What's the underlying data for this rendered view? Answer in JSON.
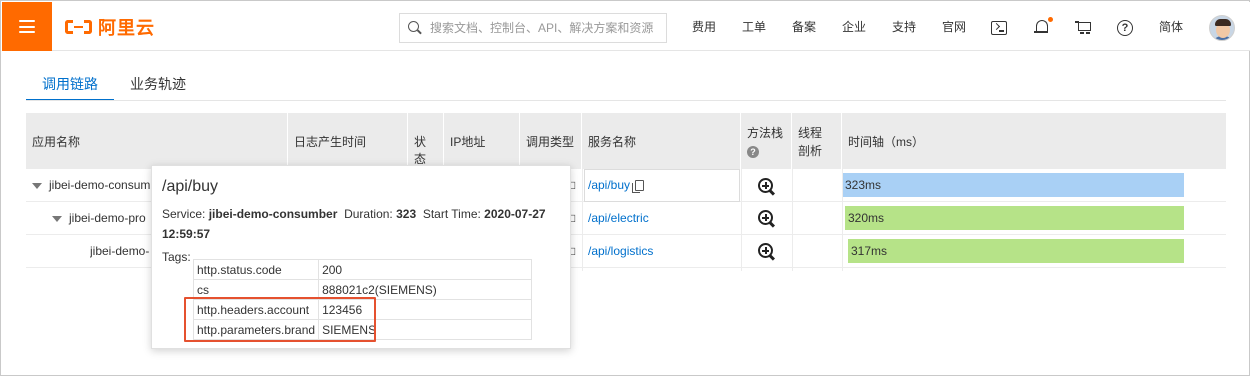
{
  "header": {
    "logo_text": "阿里云",
    "search_placeholder": "搜索文档、控制台、API、解决方案和资源",
    "nav": [
      "费用",
      "工单",
      "备案",
      "企业",
      "支持",
      "官网"
    ],
    "lang": "简体",
    "icons": [
      "menu-icon",
      "terminal-icon",
      "bell-icon",
      "cart-icon",
      "help-icon"
    ],
    "accent_color": "#ff6a00"
  },
  "tabs": [
    {
      "label": "调用链路",
      "active": true
    },
    {
      "label": "业务轨迹",
      "active": false
    }
  ],
  "table": {
    "columns": [
      "应用名称",
      "日志产生时间",
      "状态",
      "IP地址",
      "调用类型",
      "服务名称",
      "方法栈",
      "线程剖析",
      "时间轴（ms）"
    ],
    "rows": [
      {
        "app": "jibei-demo-consum",
        "type_icon": "□",
        "service": "/api/buy",
        "duration_ms": 323,
        "bar_label": "323ms",
        "bar_color": "#a9d0f5"
      },
      {
        "app": "jibei-demo-pro",
        "type_icon": "□",
        "service": "/api/electric",
        "duration_ms": 320,
        "bar_label": "320ms",
        "bar_color": "#b6e388"
      },
      {
        "app": "jibei-demo-",
        "type_icon": "□",
        "service": "/api/logistics",
        "duration_ms": 317,
        "bar_label": "317ms",
        "bar_color": "#b6e388"
      }
    ]
  },
  "popover": {
    "title": "/api/buy",
    "service_label": "Service:",
    "service_value": "jibei-demo-consumber",
    "duration_label": "Duration:",
    "duration_value": "323",
    "start_label": "Start Time:",
    "start_value": "2020-07-27 12:59:57",
    "tags_label": "Tags:",
    "tags": [
      {
        "key": "http.status.code",
        "value": "200"
      },
      {
        "key": "cs",
        "value": "888021c2(SIEMENS)"
      },
      {
        "key": "http.headers.account",
        "value": "123456"
      },
      {
        "key": "http.parameters.brand",
        "value": "SIEMENS"
      }
    ],
    "highlight_color": "#e5512f"
  }
}
